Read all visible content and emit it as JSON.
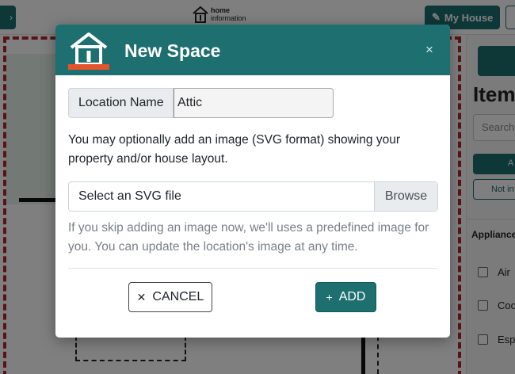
{
  "app": {
    "logo_line1": "home",
    "logo_line2": "information",
    "my_house_label": "My House",
    "panel_title": "Items",
    "search_placeholder": "Search",
    "panel_button": "A",
    "panel_button2": "Not in",
    "section_title": "Appliances",
    "items": [
      "Air",
      "Coo",
      "Esp"
    ]
  },
  "modal": {
    "title": "New Space",
    "close_glyph": "×",
    "location_label": "Location Name",
    "location_value": "Attic",
    "help_text": "You may optionally add an image (SVG format) showing your property and/or house layout.",
    "file_placeholder": "Select an SVG file",
    "browse_label": "Browse",
    "muted_text": "If you skip adding an image now, we'll uses a predefined image for you. You can update the location's image at any time.",
    "cancel_icon": "✕",
    "cancel_label": "CANCEL",
    "add_icon": "+",
    "add_label": "ADD"
  },
  "colors": {
    "accent": "#1d6f70",
    "plan_border": "#b3262a",
    "logo_base": "#e5532d"
  }
}
